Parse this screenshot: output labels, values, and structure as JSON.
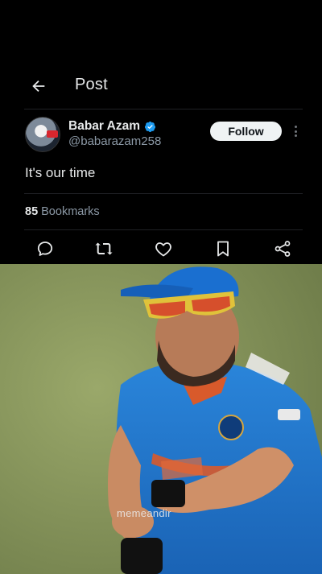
{
  "header": {
    "title": "Post",
    "back_icon": "arrow-left-icon"
  },
  "author": {
    "name": "Babar Azam",
    "handle": "@babarazam258",
    "verified": true,
    "verified_color": "#1d9bf0",
    "avatar_icon": "avatar-image"
  },
  "follow_button": {
    "label": "Follow"
  },
  "more_icon": "more-vertical-icon",
  "tweet": {
    "text": "It's our time"
  },
  "stats": {
    "bookmarks_count": "85",
    "bookmarks_label": "Bookmarks"
  },
  "actions": [
    {
      "icon": "reply-icon"
    },
    {
      "icon": "retweet-icon"
    },
    {
      "icon": "like-icon"
    },
    {
      "icon": "bookmark-icon"
    },
    {
      "icon": "share-icon"
    }
  ],
  "media": {
    "type": "video",
    "description_icon": "cricket-player-video",
    "watermark": "memeandir",
    "colors": {
      "pitch": "#8b9a5f",
      "jersey": "#1e78d0",
      "cap": "#1a6fd0",
      "sunglasses": "#e0c23a"
    }
  }
}
